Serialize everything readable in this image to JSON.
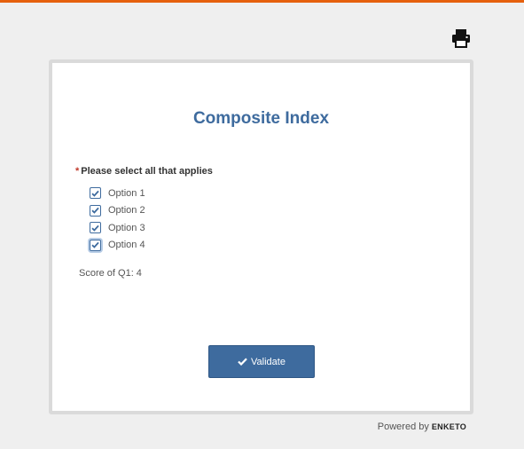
{
  "header": {
    "print_icon": "printer-icon"
  },
  "form": {
    "title": "Composite Index",
    "question": {
      "required_marker": "*",
      "label": "Please select all that applies",
      "options": [
        {
          "label": "Option 1",
          "checked": true
        },
        {
          "label": "Option 2",
          "checked": true
        },
        {
          "label": "Option 3",
          "checked": true
        },
        {
          "label": "Option 4",
          "checked": true
        }
      ]
    },
    "score_text": "Score of Q1: 4",
    "validate_label": "Validate"
  },
  "footer": {
    "powered_by": "Powered by",
    "brand": "ENKETO"
  },
  "colors": {
    "accent": "#e5600d",
    "primary": "#3e6b9e",
    "background": "#efefef"
  }
}
